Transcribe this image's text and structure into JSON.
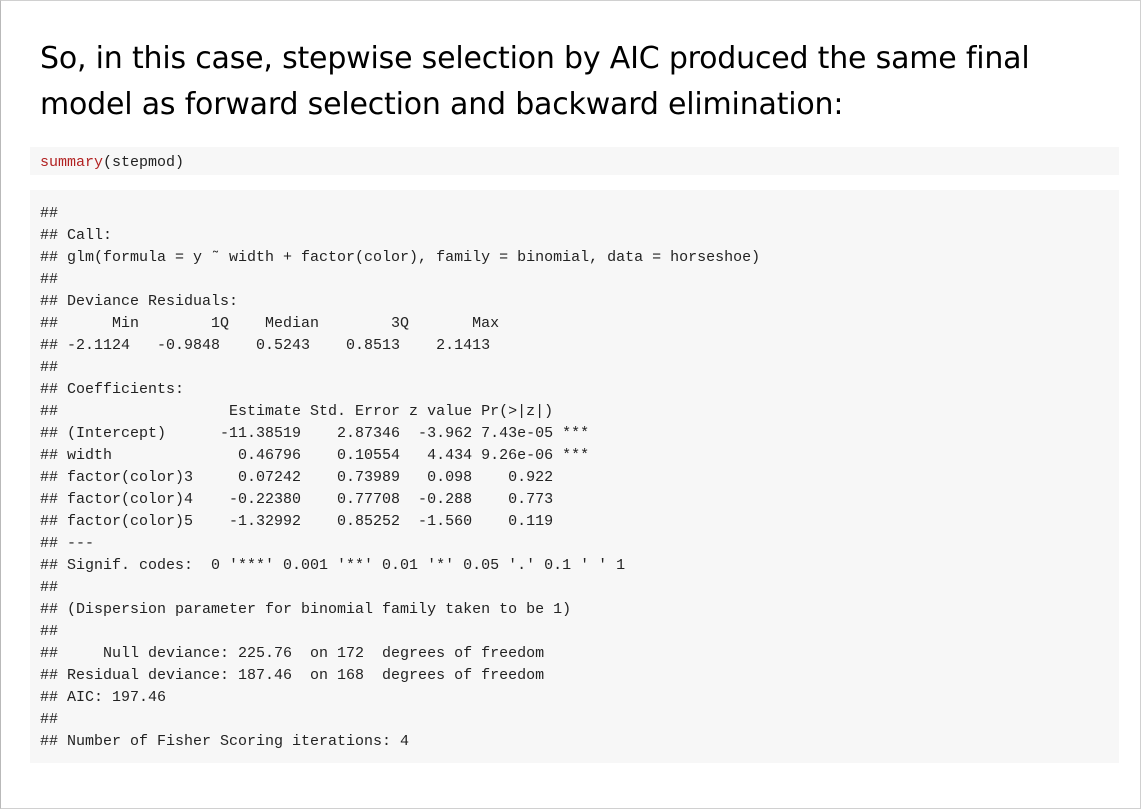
{
  "heading": "So, in this case, stepwise selection by AIC produced the same final model as forward selection and backward elimination:",
  "code": {
    "function": "summary",
    "args": "(stepmod)"
  },
  "output_lines": [
    "##",
    "## Call:",
    "## glm(formula = y ˜ width + factor(color), family = binomial, data = horseshoe)",
    "##",
    "## Deviance Residuals:",
    "##      Min        1Q    Median        3Q       Max",
    "## -2.1124   -0.9848    0.5243    0.8513    2.1413",
    "##",
    "## Coefficients:",
    "##                   Estimate Std. Error z value Pr(>|z|)",
    "## (Intercept)      -11.38519    2.87346  -3.962 7.43e-05 ***",
    "## width              0.46796    0.10554   4.434 9.26e-06 ***",
    "## factor(color)3     0.07242    0.73989   0.098    0.922",
    "## factor(color)4    -0.22380    0.77708  -0.288    0.773",
    "## factor(color)5    -1.32992    0.85252  -1.560    0.119",
    "## ---",
    "## Signif. codes:  0 '***' 0.001 '**' 0.01 '*' 0.05 '.' 0.1 ' ' 1",
    "##",
    "## (Dispersion parameter for binomial family taken to be 1)",
    "##",
    "##     Null deviance: 225.76  on 172  degrees of freedom",
    "## Residual deviance: 187.46  on 168  degrees of freedom",
    "## AIC: 197.46",
    "##",
    "## Number of Fisher Scoring iterations: 4"
  ]
}
